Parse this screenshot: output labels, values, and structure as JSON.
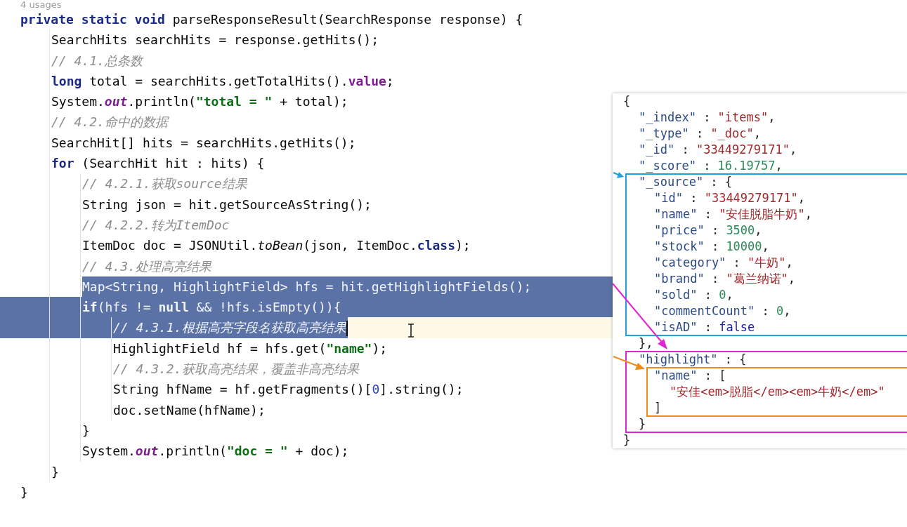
{
  "usages": "4 usages",
  "code": [
    {
      "selected": false,
      "current": false,
      "tokens": [
        {
          "text": "private static void",
          "kind": "keyword"
        },
        {
          "text": " parseResponseResult(SearchResponse response) {",
          "kind": "plain"
        }
      ],
      "children": [
        {
          "selected": false,
          "current": false,
          "tokens": [
            {
              "text": "SearchHits searchHits = response.getHits();",
              "kind": "plain"
            }
          ]
        },
        {
          "selected": false,
          "current": false,
          "tokens": [
            {
              "text": "// 4.1.总条数",
              "kind": "comment"
            }
          ]
        },
        {
          "selected": false,
          "current": false,
          "tokens": [
            {
              "text": "long",
              "kind": "keyword"
            },
            {
              "text": " total = searchHits.getTotalHits().",
              "kind": "plain"
            },
            {
              "text": "value",
              "kind": "member"
            },
            {
              "text": ";",
              "kind": "plain"
            }
          ]
        },
        {
          "selected": false,
          "current": false,
          "tokens": [
            {
              "text": "System.",
              "kind": "plain"
            },
            {
              "text": "out",
              "kind": "static_field"
            },
            {
              "text": ".println(",
              "kind": "plain"
            },
            {
              "text": "\"total = \"",
              "kind": "string"
            },
            {
              "text": " + total);",
              "kind": "plain"
            }
          ]
        },
        {
          "selected": false,
          "current": false,
          "tokens": [
            {
              "text": "// 4.2.命中的数据",
              "kind": "comment"
            }
          ]
        },
        {
          "selected": false,
          "current": false,
          "tokens": [
            {
              "text": "SearchHit[] hits = searchHits.getHits();",
              "kind": "plain"
            }
          ]
        },
        {
          "selected": false,
          "current": false,
          "tokens": [
            {
              "text": "for",
              "kind": "keyword"
            },
            {
              "text": " (SearchHit hit : hits) {",
              "kind": "plain"
            }
          ],
          "children": [
            {
              "selected": false,
              "current": false,
              "tokens": [
                {
                  "text": "// 4.2.1.获取source结果",
                  "kind": "comment"
                }
              ]
            },
            {
              "selected": false,
              "current": false,
              "tokens": [
                {
                  "text": "String json = hit.getSourceAsString();",
                  "kind": "plain"
                }
              ]
            },
            {
              "selected": false,
              "current": false,
              "tokens": [
                {
                  "text": "// 4.2.2.转为ItemDoc",
                  "kind": "comment"
                }
              ]
            },
            {
              "selected": false,
              "current": false,
              "tokens": [
                {
                  "text": "ItemDoc doc = JSONUtil.",
                  "kind": "plain"
                },
                {
                  "text": "toBean",
                  "kind": "static_method"
                },
                {
                  "text": "(json, ItemDoc.",
                  "kind": "plain"
                },
                {
                  "text": "class",
                  "kind": "keyword"
                },
                {
                  "text": ");",
                  "kind": "plain"
                }
              ]
            },
            {
              "selected": false,
              "current": false,
              "tokens": [
                {
                  "text": "// 4.3.处理高亮结果",
                  "kind": "comment"
                }
              ]
            },
            {
              "selected": true,
              "current": false,
              "tokens": [
                {
                  "text": "Map<String, HighlightField> hfs = hit.getHighlightFields();",
                  "kind": "plain"
                }
              ]
            },
            {
              "selected": true,
              "current": false,
              "tokens": [
                {
                  "text": "if",
                  "kind": "keyword"
                },
                {
                  "text": "(hfs != ",
                  "kind": "plain"
                },
                {
                  "text": "null",
                  "kind": "keyword"
                },
                {
                  "text": " && !hfs.isEmpty()){",
                  "kind": "plain"
                }
              ],
              "children": [
                {
                  "selected": true,
                  "current": true,
                  "tokens": [
                    {
                      "text": "// 4.3.1.根据高亮字段名获取高亮结果",
                      "kind": "comment"
                    }
                  ]
                },
                {
                  "selected": false,
                  "current": false,
                  "tokens": [
                    {
                      "text": "HighlightField hf = hfs.get(",
                      "kind": "plain"
                    },
                    {
                      "text": "\"name\"",
                      "kind": "string"
                    },
                    {
                      "text": ");",
                      "kind": "plain"
                    }
                  ]
                },
                {
                  "selected": false,
                  "current": false,
                  "tokens": [
                    {
                      "text": "// 4.3.2.获取高亮结果，覆盖非高亮结果",
                      "kind": "comment"
                    }
                  ]
                },
                {
                  "selected": false,
                  "current": false,
                  "tokens": [
                    {
                      "text": "String hfName = hf.getFragments()[",
                      "kind": "plain"
                    },
                    {
                      "text": "0",
                      "kind": "number"
                    },
                    {
                      "text": "].string();",
                      "kind": "plain"
                    }
                  ]
                },
                {
                  "selected": false,
                  "current": false,
                  "tokens": [
                    {
                      "text": "doc.setName(hfName);",
                      "kind": "plain"
                    }
                  ]
                }
              ]
            },
            {
              "selected": false,
              "current": false,
              "tokens": [
                {
                  "text": "}",
                  "kind": "plain"
                }
              ]
            },
            {
              "selected": false,
              "current": false,
              "tokens": [
                {
                  "text": "System.",
                  "kind": "plain"
                },
                {
                  "text": "out",
                  "kind": "static_field"
                },
                {
                  "text": ".println(",
                  "kind": "plain"
                },
                {
                  "text": "\"doc = \"",
                  "kind": "string"
                },
                {
                  "text": " + doc);",
                  "kind": "plain"
                }
              ]
            }
          ]
        },
        {
          "selected": false,
          "current": false,
          "tokens": [
            {
              "text": "}",
              "kind": "plain"
            }
          ]
        }
      ]
    },
    {
      "selected": false,
      "current": false,
      "tokens": [
        {
          "text": "}",
          "kind": "plain"
        }
      ]
    }
  ],
  "result_panel": {
    "lines": [
      {
        "tokens": [
          {
            "text": "{",
            "kind": "punct"
          }
        ],
        "children": [
          {
            "tokens": [
              {
                "text": "\"_index\"",
                "kind": "key"
              },
              {
                "text": " : ",
                "kind": "punct"
              },
              {
                "text": "\"items\"",
                "kind": "string"
              },
              {
                "text": ",",
                "kind": "punct"
              }
            ]
          },
          {
            "tokens": [
              {
                "text": "\"_type\"",
                "kind": "key"
              },
              {
                "text": " : ",
                "kind": "punct"
              },
              {
                "text": "\"_doc\"",
                "kind": "string"
              },
              {
                "text": ",",
                "kind": "punct"
              }
            ]
          },
          {
            "tokens": [
              {
                "text": "\"_id\"",
                "kind": "key"
              },
              {
                "text": " : ",
                "kind": "punct"
              },
              {
                "text": "\"33449279171\"",
                "kind": "string"
              },
              {
                "text": ",",
                "kind": "punct"
              }
            ]
          },
          {
            "tokens": [
              {
                "text": "\"_score\"",
                "kind": "key"
              },
              {
                "text": " : ",
                "kind": "punct"
              },
              {
                "text": "16.19757",
                "kind": "number"
              },
              {
                "text": ",",
                "kind": "punct"
              }
            ]
          },
          {
            "tokens": [
              {
                "text": "\"_source\"",
                "kind": "key"
              },
              {
                "text": " : {",
                "kind": "punct"
              }
            ],
            "children": [
              {
                "tokens": [
                  {
                    "text": "\"id\"",
                    "kind": "key"
                  },
                  {
                    "text": " : ",
                    "kind": "punct"
                  },
                  {
                    "text": "\"33449279171\"",
                    "kind": "string"
                  },
                  {
                    "text": ",",
                    "kind": "punct"
                  }
                ]
              },
              {
                "tokens": [
                  {
                    "text": "\"name\"",
                    "kind": "key"
                  },
                  {
                    "text": " : ",
                    "kind": "punct"
                  },
                  {
                    "text": "\"安佳脱脂牛奶\"",
                    "kind": "string"
                  },
                  {
                    "text": ",",
                    "kind": "punct"
                  }
                ]
              },
              {
                "tokens": [
                  {
                    "text": "\"price\"",
                    "kind": "key"
                  },
                  {
                    "text": " : ",
                    "kind": "punct"
                  },
                  {
                    "text": "3500",
                    "kind": "number"
                  },
                  {
                    "text": ",",
                    "kind": "punct"
                  }
                ]
              },
              {
                "tokens": [
                  {
                    "text": "\"stock\"",
                    "kind": "key"
                  },
                  {
                    "text": " : ",
                    "kind": "punct"
                  },
                  {
                    "text": "10000",
                    "kind": "number"
                  },
                  {
                    "text": ",",
                    "kind": "punct"
                  }
                ]
              },
              {
                "tokens": [
                  {
                    "text": "\"category\"",
                    "kind": "key"
                  },
                  {
                    "text": " : ",
                    "kind": "punct"
                  },
                  {
                    "text": "\"牛奶\"",
                    "kind": "string"
                  },
                  {
                    "text": ",",
                    "kind": "punct"
                  }
                ]
              },
              {
                "tokens": [
                  {
                    "text": "\"brand\"",
                    "kind": "key"
                  },
                  {
                    "text": " : ",
                    "kind": "punct"
                  },
                  {
                    "text": "\"葛兰纳诺\"",
                    "kind": "string"
                  },
                  {
                    "text": ",",
                    "kind": "punct"
                  }
                ]
              },
              {
                "tokens": [
                  {
                    "text": "\"sold\"",
                    "kind": "key"
                  },
                  {
                    "text": " : ",
                    "kind": "punct"
                  },
                  {
                    "text": "0",
                    "kind": "number"
                  },
                  {
                    "text": ",",
                    "kind": "punct"
                  }
                ]
              },
              {
                "tokens": [
                  {
                    "text": "\"commentCount\"",
                    "kind": "key"
                  },
                  {
                    "text": " : ",
                    "kind": "punct"
                  },
                  {
                    "text": "0",
                    "kind": "number"
                  },
                  {
                    "text": ",",
                    "kind": "punct"
                  }
                ]
              },
              {
                "tokens": [
                  {
                    "text": "\"isAD\"",
                    "kind": "key"
                  },
                  {
                    "text": " : ",
                    "kind": "punct"
                  },
                  {
                    "text": "false",
                    "kind": "literal"
                  }
                ]
              }
            ]
          },
          {
            "tokens": [
              {
                "text": "},",
                "kind": "punct"
              }
            ]
          },
          {
            "tokens": [
              {
                "text": "\"highlight\"",
                "kind": "key"
              },
              {
                "text": " : {",
                "kind": "punct"
              }
            ],
            "children": [
              {
                "tokens": [
                  {
                    "text": "\"name\"",
                    "kind": "key"
                  },
                  {
                    "text": " : [",
                    "kind": "punct"
                  }
                ],
                "children": [
                  {
                    "tokens": [
                      {
                        "text": "\"安佳<em>脱脂</em><em>牛奶</em>\"",
                        "kind": "string"
                      }
                    ]
                  }
                ]
              },
              {
                "tokens": [
                  {
                    "text": "]",
                    "kind": "punct"
                  }
                ]
              }
            ]
          },
          {
            "tokens": [
              {
                "text": "}",
                "kind": "punct"
              }
            ]
          }
        ]
      },
      {
        "tokens": [
          {
            "text": "}",
            "kind": "punct"
          }
        ]
      }
    ]
  }
}
